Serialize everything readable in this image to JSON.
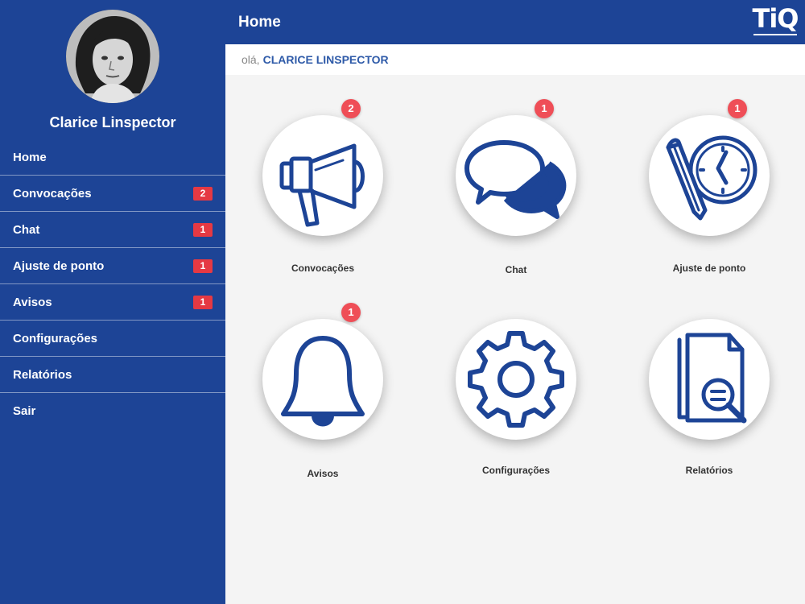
{
  "sidebar": {
    "user_name": "Clarice Linspector",
    "items": [
      {
        "label": "Home",
        "badge": ""
      },
      {
        "label": "Convocações",
        "badge": "2"
      },
      {
        "label": "Chat",
        "badge": "1"
      },
      {
        "label": "Ajuste de ponto",
        "badge": "1"
      },
      {
        "label": "Avisos",
        "badge": "1"
      },
      {
        "label": "Configurações",
        "badge": ""
      },
      {
        "label": "Relatórios",
        "badge": ""
      },
      {
        "label": "Sair",
        "badge": ""
      }
    ]
  },
  "header": {
    "title": "Home",
    "logo_text": "TiQ"
  },
  "greeting": {
    "hello": "olá,",
    "name": "CLARICE LINSPECTOR"
  },
  "tiles": [
    {
      "label": "Convocações",
      "badge": "2",
      "icon": "megaphone-icon"
    },
    {
      "label": "Chat",
      "badge": "1",
      "icon": "chat-bubbles-icon"
    },
    {
      "label": "Ajuste de ponto",
      "badge": "1",
      "icon": "pencil-clock-icon"
    },
    {
      "label": "Avisos",
      "badge": "1",
      "icon": "bell-icon"
    },
    {
      "label": "Configurações",
      "badge": "",
      "icon": "gear-icon"
    },
    {
      "label": "Relatórios",
      "badge": "",
      "icon": "report-search-icon"
    }
  ],
  "colors": {
    "primary": "#1d4496",
    "badge": "#e53943",
    "icon": "#1d4496",
    "background": "#f4f4f4"
  }
}
